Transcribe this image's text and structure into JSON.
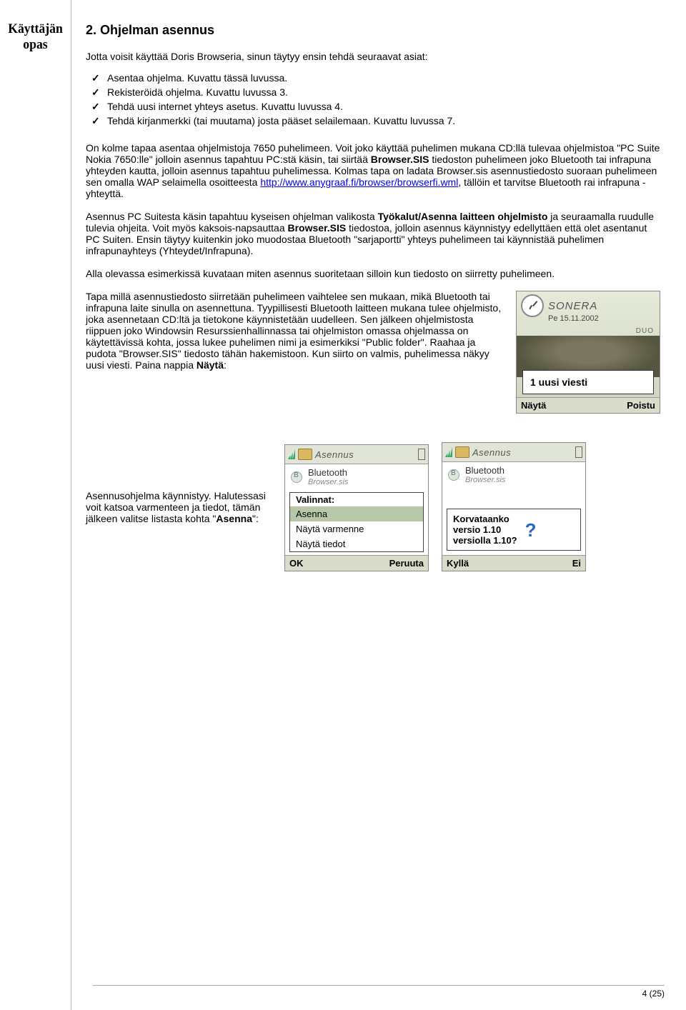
{
  "brand_line1": "Käyttäjän",
  "brand_line2": "opas",
  "heading": "2. Ohjelman asennus",
  "intro": "Jotta voisit käyttää Doris Browseria, sinun täytyy ensin tehdä seuraavat asiat:",
  "checklist": [
    "Asentaa ohjelma. Kuvattu tässä luvussa.",
    "Rekisteröidä ohjelma. Kuvattu luvussa 3.",
    "Tehdä uusi internet yhteys asetus. Kuvattu luvussa 4.",
    "Tehdä kirjanmerkki (tai muutama) josta pääset selailemaan. Kuvattu luvussa 7."
  ],
  "para1_a": "On kolme tapaa asentaa ohjelmistoja 7650 puhelimeen. Voit joko käyttää puhelimen mukana CD:llä tulevaa ohjelmistoa \"PC Suite Nokia 7650:lle\" jolloin asennus tapahtuu PC:stä käsin, tai siirtää ",
  "para1_b": "Browser.SIS",
  "para1_c": " tiedoston puhelimeen joko Bluetooth tai infrapuna yhteyden kautta, jolloin asennus tapahtuu puhelimessa. Kolmas tapa on ladata Browser.sis asennustiedosto suoraan puhelimeen sen omalla WAP selaimella osoitteesta ",
  "para1_link": "http://www.anygraaf.fi/browser/browserfi.wml",
  "para1_d": ", tällöin et tarvitse Bluetooth rai infrapuna - yhteyttä.",
  "para2_a": "Asennus PC Suitesta käsin tapahtuu kyseisen ohjelman valikosta ",
  "para2_b": "Työkalut/Asenna laitteen ohjelmisto",
  "para2_c": " ja seuraamalla ruudulle tulevia ohjeita. Voit myös kaksois-napsauttaa ",
  "para2_d": "Browser.SIS",
  "para2_e": " tiedostoa, jolloin asennus käynnistyy edellyttäen että olet asentanut PC Suiten. Ensin täytyy kuitenkin joko muodostaa Bluetooth \"sarjaportti\" yhteys puhelimeen tai käynnistää puhelimen infrapunayhteys (Yhteydet/Infrapuna).",
  "para3": "Alla olevassa esimerkissä kuvataan miten asennus suoritetaan silloin kun tiedosto on siirretty puhelimeen.",
  "para4_a": "Tapa millä asennustiedosto siirretään puhelimeen vaihtelee sen mukaan, mikä Bluetooth tai infrapuna laite sinulla on asennettuna. Tyypillisesti Bluetooth laitteen mukana tulee ohjelmisto, joka asennetaan CD:ltä ja tietokone käynnistetään uudelleen. Sen jälkeen ohjelmistosta riippuen joko Windowsin Resurssienhallinnassa tai ohjelmiston omassa ohjelmassa on käytettävissä kohta, jossa lukee puhelimen nimi ja esimerkiksi \"Public folder\". Raahaa ja pudota \"Browser.SIS\" tiedosto tähän hakemistoon. Kun siirto on valmis, puhelimessa näkyy uusi viesti. Paina nappia ",
  "para4_b": "Näytä",
  "para4_c": ":",
  "phone_home": {
    "operator": "SONERA",
    "date": "Pe 15.11.2002",
    "duo": "DUO",
    "popup": "1 uusi viesti",
    "sk_left": "Näytä",
    "sk_right": "Poistu"
  },
  "para5_a": "Asennusohjelma käynnistyy. Halutessasi voit katsoa varmenteen ja tiedot, tämän jälkeen valitse listasta kohta \"",
  "para5_b": "Asenna",
  "para5_c": "\":",
  "phone_install1": {
    "title": "Asennus",
    "item_name": "Bluetooth",
    "item_sub": "Browser.sis",
    "menu_header": "Valinnat:",
    "opts": [
      "Asenna",
      "Näytä varmenne",
      "Näytä tiedot"
    ],
    "sk_left": "OK",
    "sk_right": "Peruuta"
  },
  "phone_install2": {
    "title": "Asennus",
    "item_name": "Bluetooth",
    "item_sub": "Browser.sis",
    "confirm_l1": "Korvataanko",
    "confirm_l2": "versio 1.10",
    "confirm_l3": "versiolla 1.10?",
    "sk_left": "Kyllä",
    "sk_right": "Ei"
  },
  "page_number": "4 (25)"
}
